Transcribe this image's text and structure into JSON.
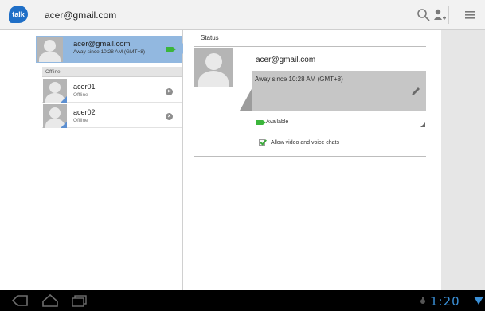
{
  "app": {
    "logo_text": "talk",
    "account": "acer@gmail.com"
  },
  "actions": {
    "search_icon": "search-icon",
    "add_friend_icon": "add-friend-icon",
    "menu_icon": "menu-icon"
  },
  "me": {
    "email": "acer@gmail.com",
    "status": "Away since 10:28 AM (GMT+8)"
  },
  "friends_section": {
    "label": "Offline",
    "items": [
      {
        "name": "acer01",
        "status": "Offline"
      },
      {
        "name": "acer02",
        "status": "Offline"
      }
    ]
  },
  "status_panel": {
    "title": "Status",
    "email": "acer@gmail.com",
    "status_message": "Away since 10:28 AM (GMT+8)",
    "availability": "Available",
    "allow_label": "Allow video and voice chats",
    "allow_checked": true
  },
  "system_bar": {
    "clock": "1:20"
  },
  "colors": {
    "selected": "#92b8e0",
    "available": "#3bb53b",
    "clock": "#3a8fd6"
  }
}
